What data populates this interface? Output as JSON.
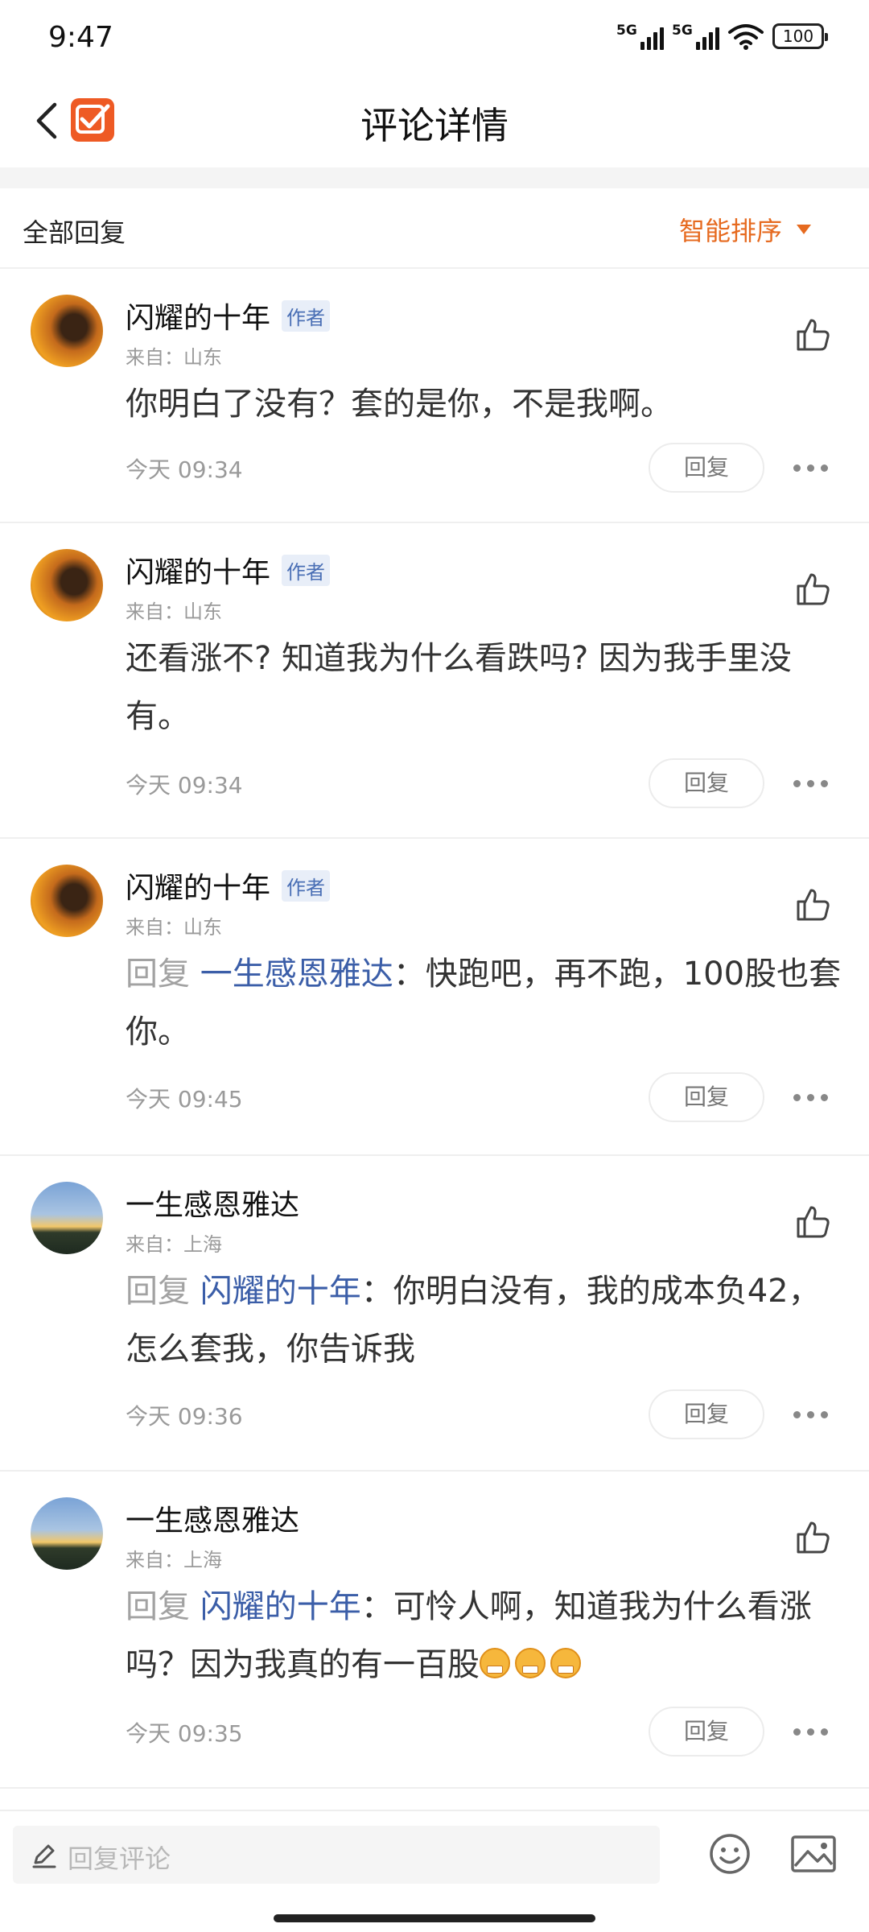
{
  "status_bar": {
    "time": "9:47",
    "network_1": "5G",
    "network_2": "5G",
    "battery": "100"
  },
  "nav": {
    "title": "评论详情",
    "back_icon": "chevron-left-icon",
    "logo_icon": "app-logo-checkbox-icon"
  },
  "filter": {
    "all_label": "全部回复",
    "sort_label": "智能排序"
  },
  "comments": [
    {
      "author": "闪耀的十年",
      "badge": "作者",
      "from": "来自：山东",
      "reply_prefix": "",
      "mention": "",
      "text": "你明白了没有？套的是你，不是我啊。",
      "time": "今天 09:34",
      "reply_label": "回复"
    },
    {
      "author": "闪耀的十年",
      "badge": "作者",
      "from": "来自：山东",
      "reply_prefix": "",
      "mention": "",
      "text": "还看涨不? 知道我为什么看跌吗? 因为我手里没有。",
      "time": "今天 09:34",
      "reply_label": "回复"
    },
    {
      "author": "闪耀的十年",
      "badge": "作者",
      "from": "来自：山东",
      "reply_prefix": "回复",
      "mention": "一生感恩雅达",
      "text": "：快跑吧，再不跑，100股也套你。",
      "time": "今天 09:45",
      "reply_label": "回复"
    },
    {
      "author": "一生感恩雅达",
      "badge": "",
      "from": "来自：上海",
      "reply_prefix": "回复",
      "mention": "闪耀的十年",
      "text": "：你明白没有，我的成本负42，怎么套我，你告诉我",
      "time": "今天 09:36",
      "reply_label": "回复"
    },
    {
      "author": "一生感恩雅达",
      "badge": "",
      "from": "来自：上海",
      "reply_prefix": "回复",
      "mention": "闪耀的十年",
      "text": "：可怜人啊，知道我为什么看涨吗？因为我真的有一百股",
      "time": "今天 09:35",
      "reply_label": "回复"
    }
  ],
  "bottom_bar": {
    "placeholder": "回复评论"
  }
}
